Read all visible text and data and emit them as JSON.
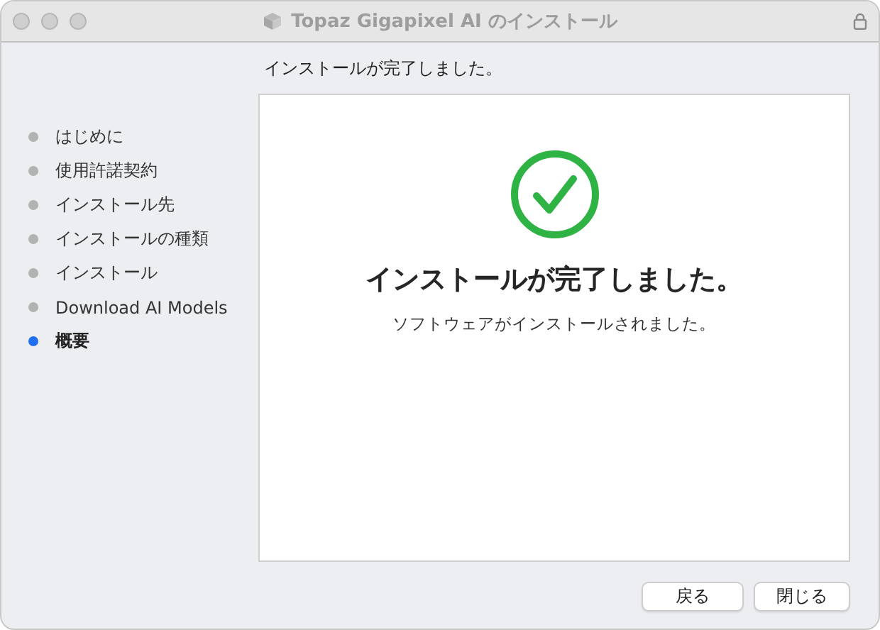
{
  "window": {
    "title": "Topaz Gigapixel AI のインストール"
  },
  "header": "インストールが完了しました。",
  "steps": [
    {
      "label": "はじめに",
      "selected": false
    },
    {
      "label": "使用許諾契約",
      "selected": false
    },
    {
      "label": "インストール先",
      "selected": false
    },
    {
      "label": "インストールの種類",
      "selected": false
    },
    {
      "label": "インストール",
      "selected": false
    },
    {
      "label": "Download AI Models",
      "selected": false
    },
    {
      "label": "概要",
      "selected": true
    }
  ],
  "result": {
    "title": "インストールが完了しました。",
    "message": "ソフトウェアがインストールされました。"
  },
  "buttons": [
    "戻る",
    "閉じる"
  ]
}
